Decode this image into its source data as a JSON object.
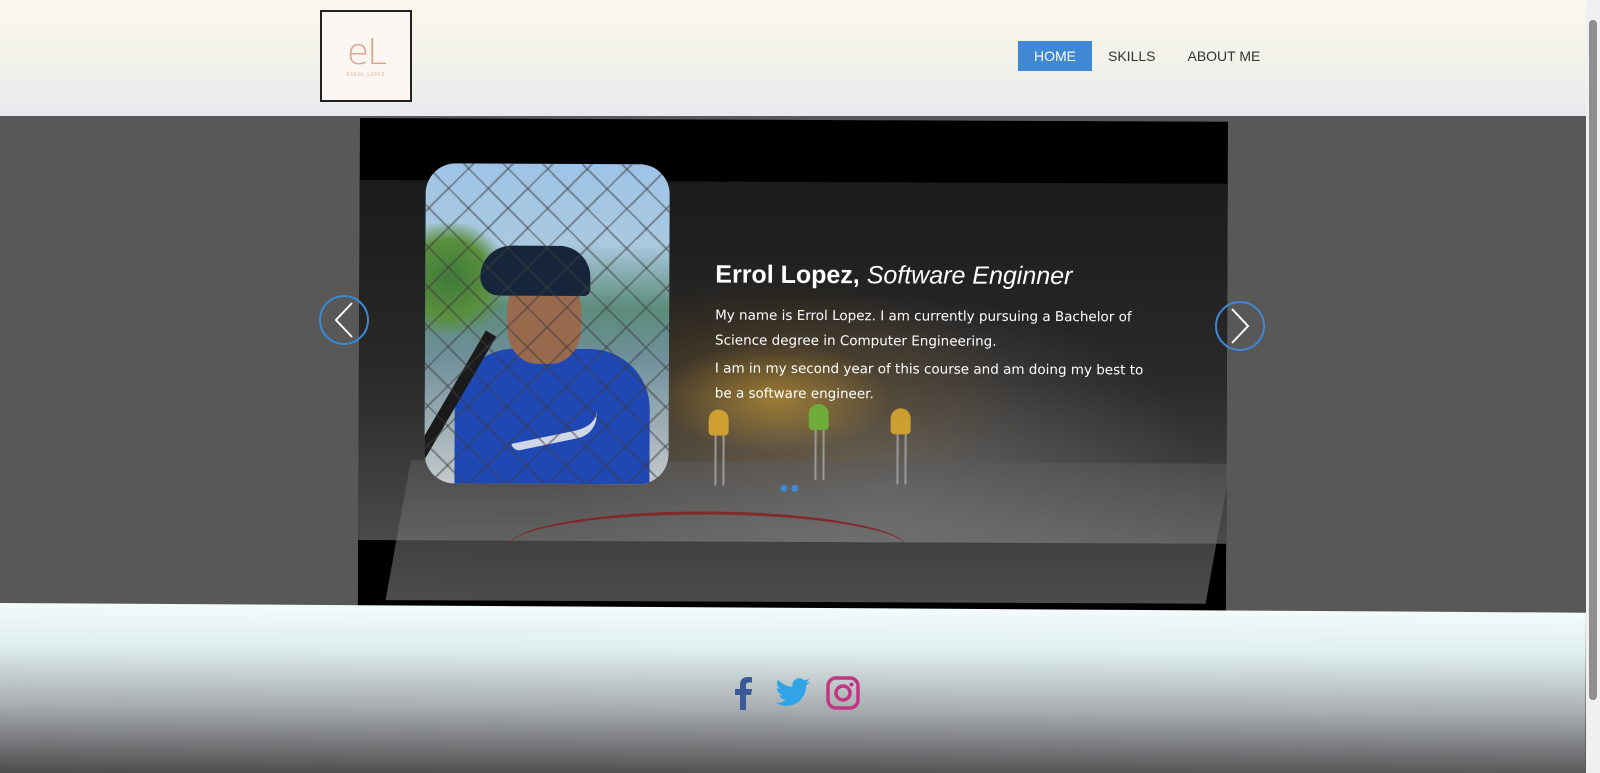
{
  "header": {
    "logo_mark": "eL",
    "logo_sub": "ERROL LOPEZ",
    "nav": [
      {
        "label": "HOME",
        "active": true
      },
      {
        "label": "SKILLS",
        "active": false
      },
      {
        "label": "ABOUT ME",
        "active": false
      }
    ]
  },
  "slider": {
    "title_name": "Errol Lopez,",
    "title_role": "Software Enginner",
    "paragraph_1": "My name is Errol Lopez. I am currently pursuing a Bachelor of Science degree in Computer Engineering.",
    "paragraph_2": "I am in my second year of this course and am doing my best to be a software engineer.",
    "slide_count": 2
  },
  "footer": {
    "social": [
      {
        "name": "facebook-icon",
        "color": "#3b5998"
      },
      {
        "name": "twitter-icon",
        "color": "#2fa4e7"
      },
      {
        "name": "instagram-icon",
        "color": "#c13584"
      }
    ]
  },
  "colors": {
    "accent": "#3e88d4"
  }
}
